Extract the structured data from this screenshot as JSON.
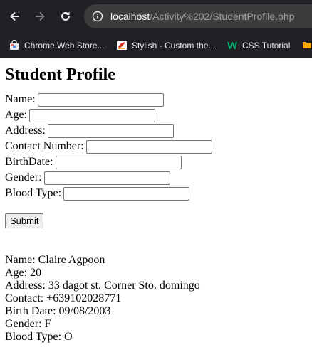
{
  "browser": {
    "url_host": "localhost",
    "url_path": "/Activity%202/StudentProfile.php",
    "bookmarks": [
      {
        "label": "Chrome Web Store...",
        "icon": "chrome-web-store-icon"
      },
      {
        "label": "Stylish - Custom the...",
        "icon": "stylish-icon"
      },
      {
        "label": "CSS Tutorial",
        "icon": "w3schools-icon"
      }
    ]
  },
  "page": {
    "title": "Student Profile",
    "form": {
      "fields": [
        {
          "label": "Name:",
          "value": ""
        },
        {
          "label": "Age:",
          "value": ""
        },
        {
          "label": "Address:",
          "value": ""
        },
        {
          "label": "Contact Number:",
          "value": ""
        },
        {
          "label": "BirthDate:",
          "value": ""
        },
        {
          "label": "Gender:",
          "value": ""
        },
        {
          "label": "Blood Type:",
          "value": ""
        }
      ],
      "submit_label": "Submit"
    },
    "output": [
      "Name: Claire Agpoon",
      "Age: 20",
      "Address: 33 dagot st. Corner Sto. domingo",
      "Contact: +639102028771",
      "Birth Date: 09/08/2003",
      "Gender: F",
      "Blood Type: O"
    ]
  }
}
